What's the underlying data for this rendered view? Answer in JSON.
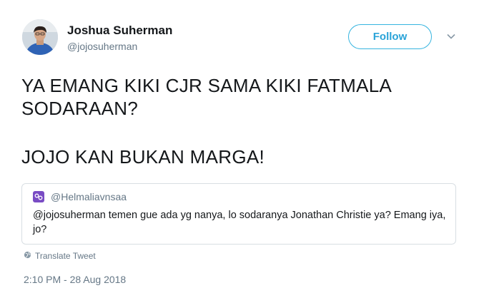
{
  "author": {
    "name": "Joshua Suherman",
    "handle": "@jojosuherman"
  },
  "follow_button": {
    "label": "Follow"
  },
  "tweet": {
    "paragraphs": [
      "YA EMANG KIKI CJR SAMA KIKI FATMALA SODARAAN?",
      "JOJO KAN BUKAN MARGA!"
    ]
  },
  "quoted_tweet": {
    "handle": "@Helmaliavnsaa",
    "text": "@jojosuherman temen gue ada yg nanya, lo sodaranya Jonathan Christie ya? Emang iya, jo?"
  },
  "translate_label": "Translate Tweet",
  "timestamp": "2:10 PM - 28 Aug 2018",
  "colors": {
    "accent": "#1da1f2",
    "follow_text": "#29a3d8",
    "secondary_text": "#657786",
    "quote_icon": "#794bc4"
  },
  "icons": {
    "chevron": "chevron-down-icon",
    "quote_avatar": "crab-icon",
    "globe": "globe-icon"
  }
}
